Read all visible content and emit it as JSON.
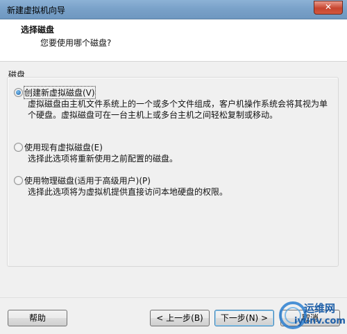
{
  "window": {
    "title": "新建虚拟机向导",
    "close_glyph": "✕"
  },
  "header": {
    "title": "选择磁盘",
    "subtitle": "您要使用哪个磁盘?"
  },
  "group": {
    "label": "磁盘"
  },
  "options": [
    {
      "label": "创建新虚拟磁盘(V)",
      "description": "虚拟磁盘由主机文件系统上的一个或多个文件组成，客户机操作系统会将其视为单个硬盘。虚拟磁盘可在一台主机上或多台主机之间轻松复制或移动。",
      "checked": true
    },
    {
      "label": "使用现有虚拟磁盘(E)",
      "description": "选择此选项将重新使用之前配置的磁盘。",
      "checked": false
    },
    {
      "label": "使用物理磁盘(适用于高级用户)(P)",
      "description": "选择此选项将为虚拟机提供直接访问本地硬盘的权限。",
      "checked": false
    }
  ],
  "footer": {
    "help": "帮助",
    "back": "< 上一步(B)",
    "next": "下一步(N) >",
    "cancel": "取消"
  },
  "watermark": {
    "line1": "运维网",
    "line2": "iyunv.com",
    "accent": "#1e5fa8"
  }
}
